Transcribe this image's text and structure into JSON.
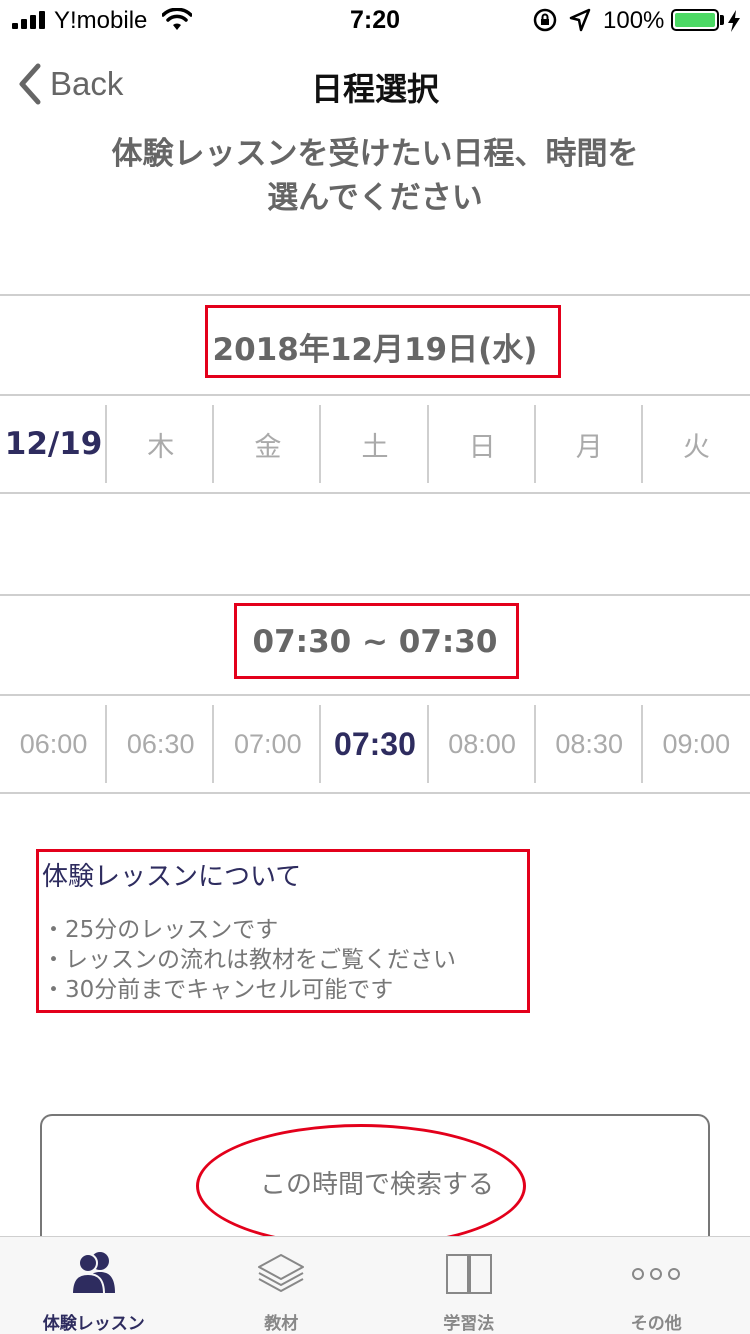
{
  "status": {
    "carrier": "Y!mobile",
    "time": "7:20",
    "battery": "100%",
    "battery_level": 1.0
  },
  "nav": {
    "back_label": "Back",
    "title": "日程選択"
  },
  "instruction": {
    "line1": "体験レッスンを受けたい日程、時間を",
    "line2": "選んでください"
  },
  "date": {
    "selected": "2018年12月19日(水)",
    "days": [
      "12/19",
      "木",
      "金",
      "土",
      "日",
      "月",
      "火"
    ],
    "active_index": 0
  },
  "time": {
    "selected": "07:30 ~ 07:30",
    "slots": [
      "06:00",
      "06:30",
      "07:00",
      "07:30",
      "08:00",
      "08:30",
      "09:00"
    ],
    "active_index": 3
  },
  "info": {
    "title": "体験レッスンについて",
    "lines": [
      "・25分のレッスンです",
      "・レッスンの流れは教材をご覧ください",
      "・30分前までキャンセル可能です"
    ]
  },
  "search": {
    "label": "この時間で検索する"
  },
  "tabbar": {
    "items": [
      {
        "label": "体験レッスン",
        "icon": "users-icon"
      },
      {
        "label": "教材",
        "icon": "layers-icon"
      },
      {
        "label": "学習法",
        "icon": "book-icon"
      },
      {
        "label": "その他",
        "icon": "more-icon"
      }
    ],
    "active_index": 0
  },
  "colors": {
    "accent": "#2e2c5f",
    "annotation": "#e3001b",
    "battery": "#4cd964"
  }
}
